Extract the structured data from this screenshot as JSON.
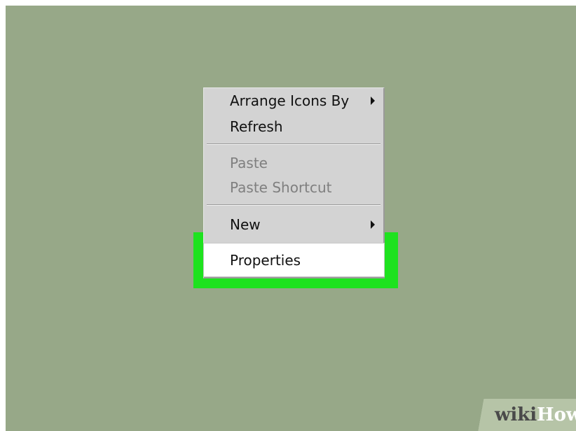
{
  "context_menu": {
    "items": [
      {
        "label": "Arrange Icons By",
        "enabled": true,
        "submenu": true
      },
      {
        "label": "Refresh",
        "enabled": true,
        "submenu": false
      },
      {
        "label": "Paste",
        "enabled": false,
        "submenu": false
      },
      {
        "label": "Paste Shortcut",
        "enabled": false,
        "submenu": false
      },
      {
        "label": "New",
        "enabled": true,
        "submenu": true
      },
      {
        "label": "Properties",
        "enabled": true,
        "submenu": false,
        "highlighted": true
      }
    ]
  },
  "watermark": {
    "part1": "wiki",
    "part2": "How"
  },
  "colors": {
    "desktop": "#97a888",
    "menu_background": "#d3d3d3",
    "highlight_outline": "#1ee21f",
    "disabled_text": "#7f7f7f"
  }
}
